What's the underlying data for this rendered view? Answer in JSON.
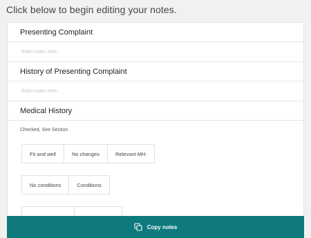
{
  "heading": "Click below to begin editing your notes.",
  "sections": [
    {
      "title": "Presenting Complaint",
      "placeholder": "Enter notes here..."
    },
    {
      "title": "History of Presenting Complaint",
      "placeholder": "Enter notes here..."
    },
    {
      "title": "Medical History",
      "status": "Checked, See Section",
      "chip_rows": [
        [
          "Fit and well",
          "No changes",
          "Relevant MH:"
        ],
        [
          "No conditions",
          "Conditions"
        ],
        [
          "",
          ""
        ]
      ]
    }
  ],
  "copy_button": {
    "label": "Copy notes",
    "icon": "copy-icon"
  },
  "colors": {
    "accent": "#0f7a7e",
    "background": "#f1f1f1"
  }
}
